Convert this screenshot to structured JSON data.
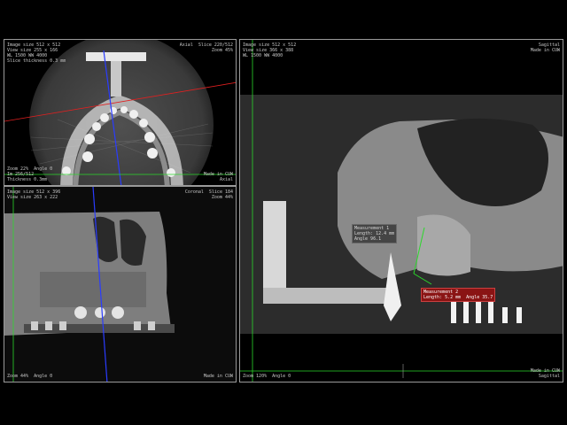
{
  "colors": {
    "frame": "#9a9a9a",
    "crosshair_green": "#2bd82b",
    "crosshair_blue": "#2a3cff",
    "crosshair_red": "#e02020",
    "measure_red": "#8a1414"
  },
  "axial": {
    "top_left": "Image size 512 x 512\nView size 255 x 166\nWL 1500 WW 4000\nSlice thickness 0.3 mm",
    "top_right": "Axial  Slice 220/512\nZoom 45%",
    "bottom_left": "Zoom 22%  Angle 0\nIm 256/512\nThickness 0.3mm",
    "bottom_right": "Made in CUW\nAxial"
  },
  "coronal": {
    "top_left": "Image size 512 x 396\nView size 263 x 222",
    "top_right": "Coronal  Slice 184\nZoom 44%",
    "bottom_left": "Zoom 44%  Angle 0",
    "bottom_right": "Made in CUW"
  },
  "sagittal": {
    "top_left": "Image size 512 x 512\nView size 366 x 388\nWL 1500 WW 4000",
    "top_right": "Sagittal\nMade in CUW",
    "bottom_left": "Zoom 120%  Angle 0",
    "bottom_right": "Made in CUW\nSagittal",
    "measure_green": "Measurement 1\nLength: 12.4 mm\nAngle 96.1",
    "measure_red": "Measurement 2\nLength: 5.2 mm  Angle 35.7"
  }
}
